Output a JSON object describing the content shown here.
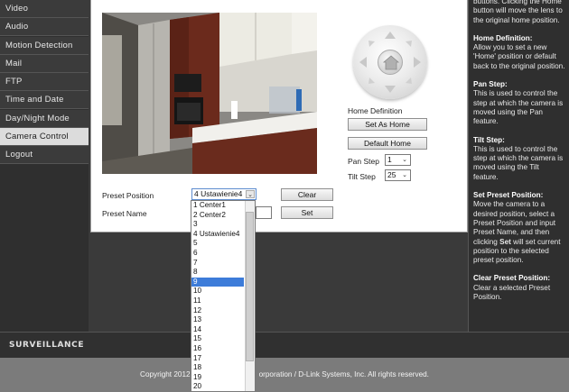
{
  "sidebar": {
    "items": [
      {
        "label": "Video"
      },
      {
        "label": "Audio"
      },
      {
        "label": "Motion Detection"
      },
      {
        "label": "Mail"
      },
      {
        "label": "FTP"
      },
      {
        "label": "Time and Date"
      },
      {
        "label": "Day/Night Mode"
      },
      {
        "label": "Camera Control"
      },
      {
        "label": "Logout"
      }
    ],
    "active": "Camera Control"
  },
  "controls": {
    "home_definition_label": "Home Definition",
    "set_as_home": "Set As Home",
    "default_home": "Default Home",
    "pan_step_label": "Pan Step",
    "pan_step_value": "1",
    "tilt_step_label": "Tilt Step",
    "tilt_step_value": "25",
    "preset_position_label": "Preset Position",
    "preset_position_value": "4 Ustawienie4",
    "preset_name_label": "Preset Name",
    "clear_button": "Clear",
    "set_button": "Set"
  },
  "dropdown": {
    "options": [
      "1 Center1",
      "2 Center2",
      "3",
      "4 Ustawienie4",
      "5",
      "6",
      "7",
      "8",
      "9",
      "10",
      "11",
      "12",
      "13",
      "14",
      "15",
      "16",
      "17",
      "18",
      "19",
      "20"
    ],
    "highlighted": "9"
  },
  "help": {
    "intro": "buttons. Clicking the Home button will move the lens to the original home position.",
    "home_def_title": "Home Definition:",
    "home_def_text": "Allow you to set a new 'Home' position or default back to the original position.",
    "pan_title": "Pan Step:",
    "pan_text": "This is used to control the step at which the camera is moved using the Pan feature.",
    "tilt_title": "Tilt Step:",
    "tilt_text": "This is used to control the step at which the camera is moved using the Tilt feature.",
    "set_preset_title": "Set Preset Position:",
    "set_preset_text_1": "Move the camera to a desired position, select a Preset Position and input Preset Name, and then clicking ",
    "set_preset_bold": "Set",
    "set_preset_text_2": " will set current position to the selected preset position.",
    "clear_title": "Clear Preset Position:",
    "clear_text": "Clear a selected Preset Position."
  },
  "footer": {
    "brand": "SURVEILLANCE",
    "copyright_left": "Copyright 2012",
    "copyright_right": "orporation / D-Link Systems, Inc. All rights reserved."
  }
}
